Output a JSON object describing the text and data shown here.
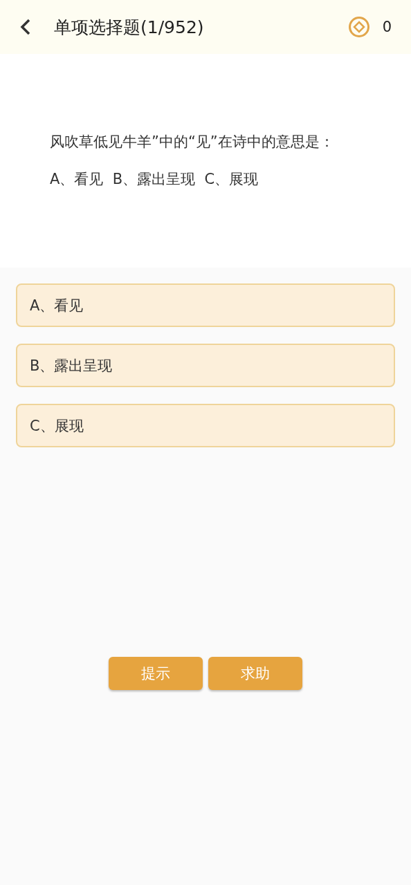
{
  "header": {
    "title": "单项选择题(1/952)",
    "coins": "0"
  },
  "question": {
    "text": "风吹草低见牛羊”中的“见”在诗中的意思是：",
    "choices_line": "A、看见  B、露出呈现  C、展现"
  },
  "options": [
    {
      "label": "A、看见",
      "selected": false
    },
    {
      "label": "B、露出呈现",
      "selected": false
    },
    {
      "label": "C、展现",
      "selected": false
    }
  ],
  "buttons": [
    "提示",
    "求助"
  ]
}
